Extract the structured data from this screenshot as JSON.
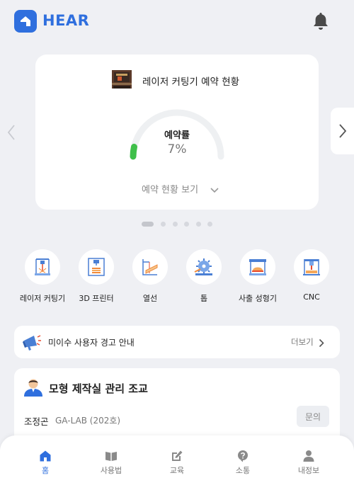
{
  "app": {
    "brand": "HEAR"
  },
  "colors": {
    "accent": "#2f6fde",
    "background": "#eff0f4",
    "gauge_fill": "#3fbf4a"
  },
  "icons": {
    "logo": "house-logo-icon",
    "notifications": "bell-icon"
  },
  "reservation_card": {
    "title": "레이저 커팅기 예약 현황",
    "gauge_label": "예약률",
    "gauge_value": "7%",
    "gauge_fraction": 0.07,
    "view_status": "예약 현황 보기",
    "carousel": {
      "pages": 6,
      "active_page": 1
    }
  },
  "machines": [
    {
      "label": "레이저 커팅기",
      "icon": "laser-cutter-icon"
    },
    {
      "label": "3D 프린터",
      "icon": "3d-printer-icon"
    },
    {
      "label": "열선",
      "icon": "hot-wire-icon"
    },
    {
      "label": "톱",
      "icon": "saw-icon"
    },
    {
      "label": "사출 성형기",
      "icon": "injection-molder-icon"
    },
    {
      "label": "CNC",
      "icon": "cnc-icon"
    }
  ],
  "notice": {
    "text": "미이수 사용자 경고 안내",
    "more": "더보기",
    "icon": "megaphone-icon"
  },
  "manager": {
    "title": "모형 제작실 관리 조교",
    "name": "조정곤",
    "lab": "GA-LAB (202호)",
    "inquiry_button": "문의"
  },
  "tabbar": {
    "active": "홈",
    "items": [
      {
        "label": "홈",
        "icon": "home-icon"
      },
      {
        "label": "사용법",
        "icon": "book-icon"
      },
      {
        "label": "교육",
        "icon": "edit-icon"
      },
      {
        "label": "소통",
        "icon": "question-icon"
      },
      {
        "label": "내정보",
        "icon": "person-icon"
      }
    ]
  }
}
